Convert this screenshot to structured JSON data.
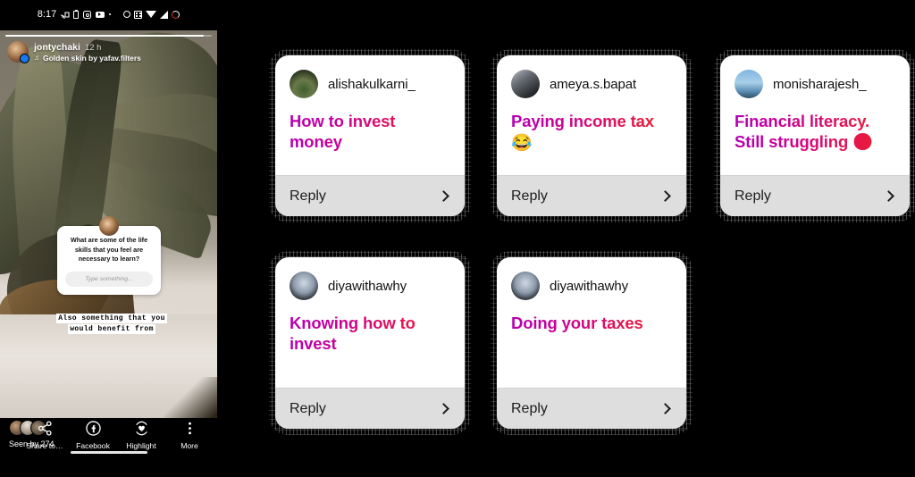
{
  "phone": {
    "status_bar": {
      "clock": "8:17",
      "left_icons": [
        "cast-icon",
        "battery-saver-icon",
        "instagram-icon",
        "youtube-icon",
        "more-notification-dot-icon"
      ],
      "right_icons": [
        "alarm-icon",
        "screenshot-grid-icon",
        "wifi-icon",
        "signal-icon",
        "battery-circle-icon"
      ]
    },
    "story": {
      "username": "jontychaki",
      "timestamp": "12 h",
      "music_icon": "music-note-icon",
      "music_label": "Golden skin by yafav.filters",
      "question_sticker": {
        "question": "What are some of the life skills that you feel are necessary to learn?",
        "input_placeholder": "Type something..."
      },
      "overlay_text_lines": [
        "Also something that you",
        "would benefit from"
      ]
    },
    "footer": {
      "seen_label": "Seen by 274",
      "actions": [
        {
          "icon": "share-icon",
          "label": "Share to…"
        },
        {
          "icon": "facebook-icon",
          "label": "Facebook"
        },
        {
          "icon": "highlight-heart-icon",
          "label": "Highlight"
        },
        {
          "icon": "more-vertical-icon",
          "label": "More"
        }
      ]
    }
  },
  "cards": [
    {
      "username": "alishakulkarni_",
      "answer": "How to invest money",
      "emoji": "",
      "reply_label": "Reply",
      "chevron_icon": "chevron-right-icon",
      "avatar": "avatar-alishakulkarni"
    },
    {
      "username": "ameya.s.bapat",
      "answer": "Paying income tax",
      "emoji": "😂",
      "reply_label": "Reply",
      "chevron_icon": "chevron-right-icon",
      "avatar": "avatar-ameya"
    },
    {
      "username": "monisharajesh_",
      "answer": "Financial literacy. Still struggling 🥲",
      "emoji": "",
      "reply_label": "Reply",
      "chevron_icon": "chevron-right-icon",
      "avatar": "avatar-monisha"
    },
    {
      "username": "diyawithawhy",
      "answer": "Knowing how to invest",
      "emoji": "",
      "reply_label": "Reply",
      "chevron_icon": "chevron-right-icon",
      "avatar": "avatar-diya-1"
    },
    {
      "username": "diyawithawhy",
      "answer": "Doing your taxes",
      "emoji": "",
      "reply_label": "Reply",
      "chevron_icon": "chevron-right-icon",
      "avatar": "avatar-diya-2"
    }
  ],
  "colors": {
    "gradient_start": "#b500b5",
    "gradient_end": "#ee2222",
    "reply_bar": "#dedede",
    "card_bg": "#ffffff",
    "page_bg": "#000000"
  }
}
